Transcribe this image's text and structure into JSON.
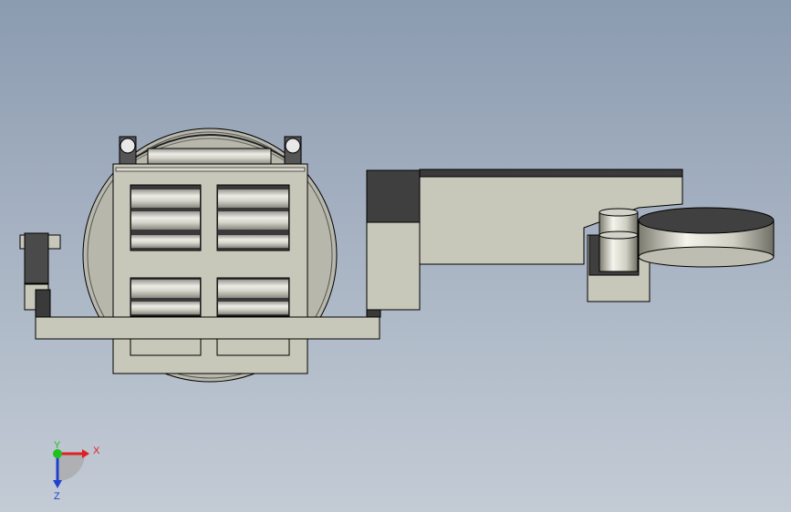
{
  "viewport": {
    "background_top": "#8b9bb0",
    "background_bottom": "#c3cbd5"
  },
  "model": {
    "part_fill": "#c8c8ba",
    "edge_color": "#000000",
    "dark_face": "#4a4a4a",
    "roller_light": "#e4e4dc",
    "roller_dark": "#8e8e86"
  },
  "triad": {
    "x_label": "X",
    "y_label": "Y",
    "z_label": "Z",
    "x_color": "#e02020",
    "y_color": "#20c020",
    "z_color": "#2040d0"
  }
}
